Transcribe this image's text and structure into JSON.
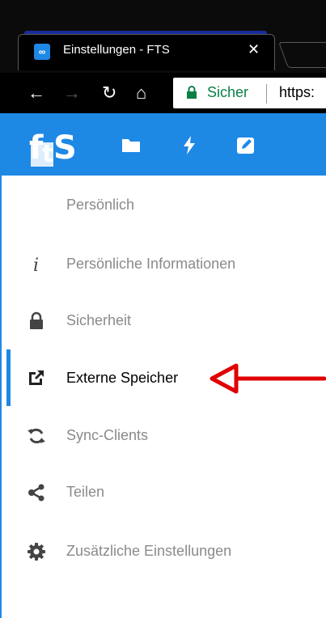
{
  "browser": {
    "tab": {
      "title": "Einstellungen - FTS",
      "close": "✕"
    },
    "omnibox": {
      "security_label": "Sicher",
      "url": "https:"
    }
  },
  "app": {
    "logo_text": "FtS",
    "header_icons": [
      "folder-icon",
      "bolt-icon",
      "edit-icon"
    ]
  },
  "sidebar": {
    "section_title": "Persönlich",
    "items": [
      {
        "label": "Persönliche Informationen",
        "icon": "info-icon",
        "active": false
      },
      {
        "label": "Sicherheit",
        "icon": "lock-icon",
        "active": false
      },
      {
        "label": "Externe Speicher",
        "icon": "external-link-icon",
        "active": true
      },
      {
        "label": "Sync-Clients",
        "icon": "sync-icon",
        "active": false
      },
      {
        "label": "Teilen",
        "icon": "share-icon",
        "active": false
      },
      {
        "label": "Zusätzliche Einstellungen",
        "icon": "gear-icon",
        "active": false
      }
    ]
  },
  "annotation": {
    "color": "#e00000"
  },
  "colors": {
    "accent": "#1e88e5",
    "secure": "#0b8043"
  }
}
